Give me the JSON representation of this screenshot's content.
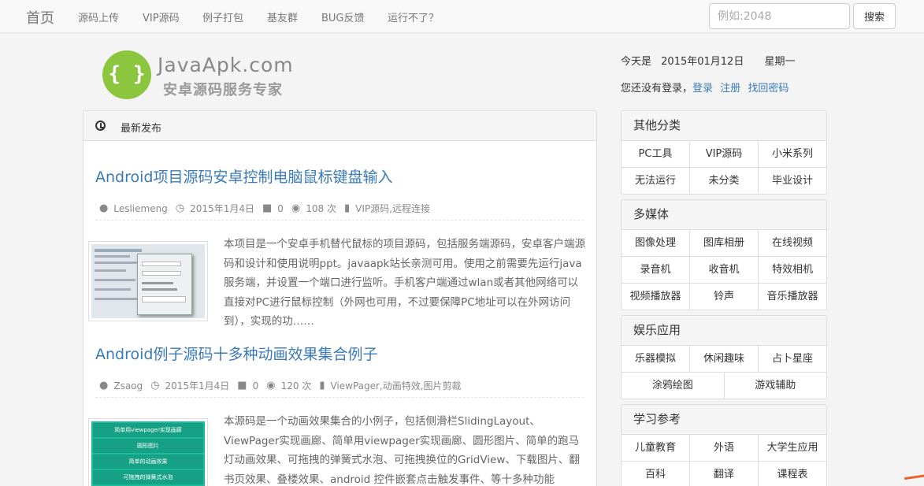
{
  "nav": {
    "brand": "首页",
    "links": [
      "源码上传",
      "VIP源码",
      "例子打包",
      "基友群",
      "BUG反馈",
      "运行不了？"
    ],
    "search_placeholder": "例如:2048",
    "search_button": "搜索"
  },
  "header": {
    "logo_title": "JavaApk.com",
    "logo_sub": "安卓源码服务专家",
    "today_label": "今天是",
    "date": "2015年01月12日",
    "weekday": "星期一",
    "login_prompt": "您还没有登录，",
    "login": "登录",
    "register": "注册",
    "recover": "找回密码"
  },
  "main": {
    "section_label": "最新发布",
    "articles": [
      {
        "title": "Android项目源码安卓控制电脑鼠标键盘输入",
        "author": "Lesliemeng",
        "date": "2015年1月4日",
        "comments": "0",
        "views": "108 次",
        "tags": "VIP源码,远程连接",
        "desc": "本项目是一个安卓手机替代鼠标的项目源码，包括服务端源码，安卓客户端源码和设计和使用说明ppt。javaapk站长亲测可用。使用之前需要先运行java服务端，并设置一个端口进行监听。手机客户端通过wlan或者其他网络可以直接对PC进行鼠标控制（外网也可用，不过要保障PC地址可以在外网访问到），实现的功……"
      },
      {
        "title": "Android例子源码十多种动画效果集合例子",
        "author": "Zsaog",
        "date": "2015年1月4日",
        "comments": "0",
        "views": "120 次",
        "tags": "ViewPager,动画特效,图片剪裁",
        "desc": "本源码是一个动画效果集合的小例子，包括侧滑栏SlidingLayout、ViewPager实现画廊、简单用viewpager实现画廊、圆形图片、简单的跑马灯动画效果、可拖拽的弹簧式水泡、可拖拽换位的GridView、下载图片、翻书页效果、叠楼效果、android 控件嵌套点击触发事件、等十多种功能或……"
      }
    ],
    "thumb2_items": [
      "简单用viewpager实现画廊",
      "圆形图片",
      "简单的动画效果",
      "可拖拽的弹簧式水泡"
    ]
  },
  "sidebar": [
    {
      "title": "其他分类",
      "rows": [
        [
          "PC工具",
          "VIP源码",
          "小米系列"
        ],
        [
          "无法运行",
          "未分类",
          "毕业设计"
        ]
      ]
    },
    {
      "title": "多媒体",
      "rows": [
        [
          "图像处理",
          "图库相册",
          "在线视频"
        ],
        [
          "录音机",
          "收音机",
          "特效相机"
        ],
        [
          "视频播放器",
          "铃声",
          "音乐播放器"
        ]
      ]
    },
    {
      "title": "娱乐应用",
      "rows": [
        [
          "乐器模拟",
          "休闲趣味",
          "占卜星座"
        ],
        [
          "涂鸦绘图",
          "游戏辅助"
        ]
      ]
    },
    {
      "title": "学习参考",
      "rows": [
        [
          "儿童教育",
          "外语",
          "大学生应用"
        ],
        [
          "百科",
          "翻译",
          "课程表"
        ]
      ]
    }
  ],
  "colors": {
    "link": "#3a7ab8",
    "logo_green": "#8cc63f",
    "thumb_green": "#1abc9c"
  }
}
